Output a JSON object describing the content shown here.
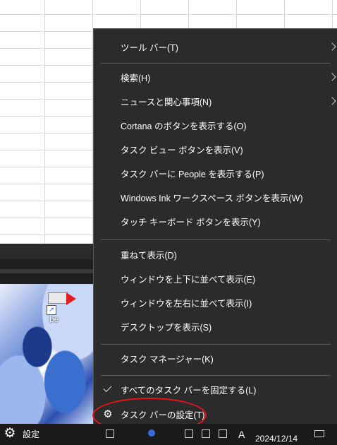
{
  "taskbar": {
    "settings_label": "設定",
    "ime_label": "A",
    "date": "2024/12/14"
  },
  "desktop": {
    "shortcut_label": "be"
  },
  "context_menu": {
    "items": [
      {
        "label": "ツール バー(T)",
        "submenu": true
      },
      {
        "label": "検索(H)",
        "submenu": true
      },
      {
        "label": "ニュースと関心事項(N)",
        "submenu": true
      },
      {
        "label": "Cortana のボタンを表示する(O)"
      },
      {
        "label": "タスク ビュー ボタンを表示(V)"
      },
      {
        "label": "タスク バーに People を表示する(P)"
      },
      {
        "label": "Windows Ink ワークスペース ボタンを表示(W)"
      },
      {
        "label": "タッチ キーボード ボタンを表示(Y)"
      },
      {
        "label": "重ねて表示(D)"
      },
      {
        "label": "ウィンドウを上下に並べて表示(E)"
      },
      {
        "label": "ウィンドウを左右に並べて表示(I)"
      },
      {
        "label": "デスクトップを表示(S)"
      },
      {
        "label": "タスク マネージャー(K)"
      },
      {
        "label": "すべてのタスク バーを固定する(L)",
        "checked": true
      },
      {
        "label": "タスク バーの設定(T)",
        "icon": "gear-icon",
        "highlighted": true
      }
    ]
  },
  "colors": {
    "menu_bg": "#2b2b2b",
    "highlight": "#e8141a",
    "taskbar_bg": "#1a1a1a"
  }
}
